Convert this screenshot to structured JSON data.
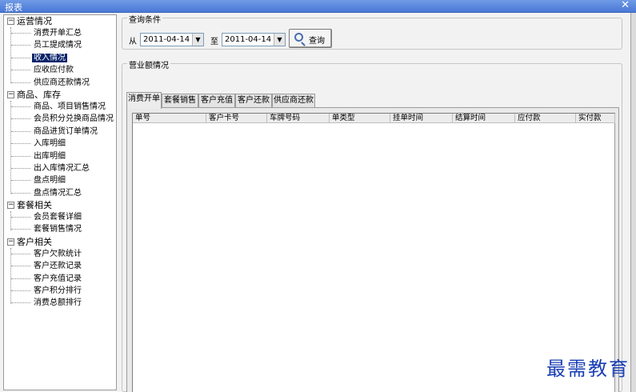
{
  "window": {
    "title": "报表",
    "close_glyph": "✕"
  },
  "tree": {
    "groups": [
      {
        "label": "运营情况",
        "toggle": "−",
        "items": [
          "消费开单汇总",
          "员工提成情况",
          "收入情况",
          "应收应付款",
          "供应商还款情况"
        ]
      },
      {
        "label": "商品、库存",
        "toggle": "−",
        "items": [
          "商品、项目销售情况",
          "会员积分兑换商品情况",
          "商品进货订单情况",
          "入库明细",
          "出库明细",
          "出入库情况汇总",
          "盘点明细",
          "盘点情况汇总"
        ]
      },
      {
        "label": "套餐相关",
        "toggle": "−",
        "items": [
          "会员套餐详细",
          "套餐销售情况"
        ]
      },
      {
        "label": "客户相关",
        "toggle": "−",
        "items": [
          "客户欠款统计",
          "客户还款记录",
          "客户充值记录",
          "客户积分排行",
          "消费总额排行"
        ]
      }
    ],
    "selected": "收入情况"
  },
  "query": {
    "legend": "查询条件",
    "from_label": "从",
    "from_date": "2011-04-14",
    "to_label": "至",
    "to_date": "2011-04-14",
    "button_label": "查询",
    "dropdown_glyph": "▼",
    "icon": "search-icon"
  },
  "revenue": {
    "legend": "营业额情况",
    "tabs": [
      "消费开单",
      "套餐销售",
      "客户充值",
      "客户还款",
      "供应商还款"
    ],
    "active_tab": 0,
    "columns": [
      "单号",
      "客户卡号",
      "车牌号码",
      "单类型",
      "挂单时间",
      "结算时间",
      "应付款",
      "实付款"
    ]
  },
  "watermark": "最需教育"
}
